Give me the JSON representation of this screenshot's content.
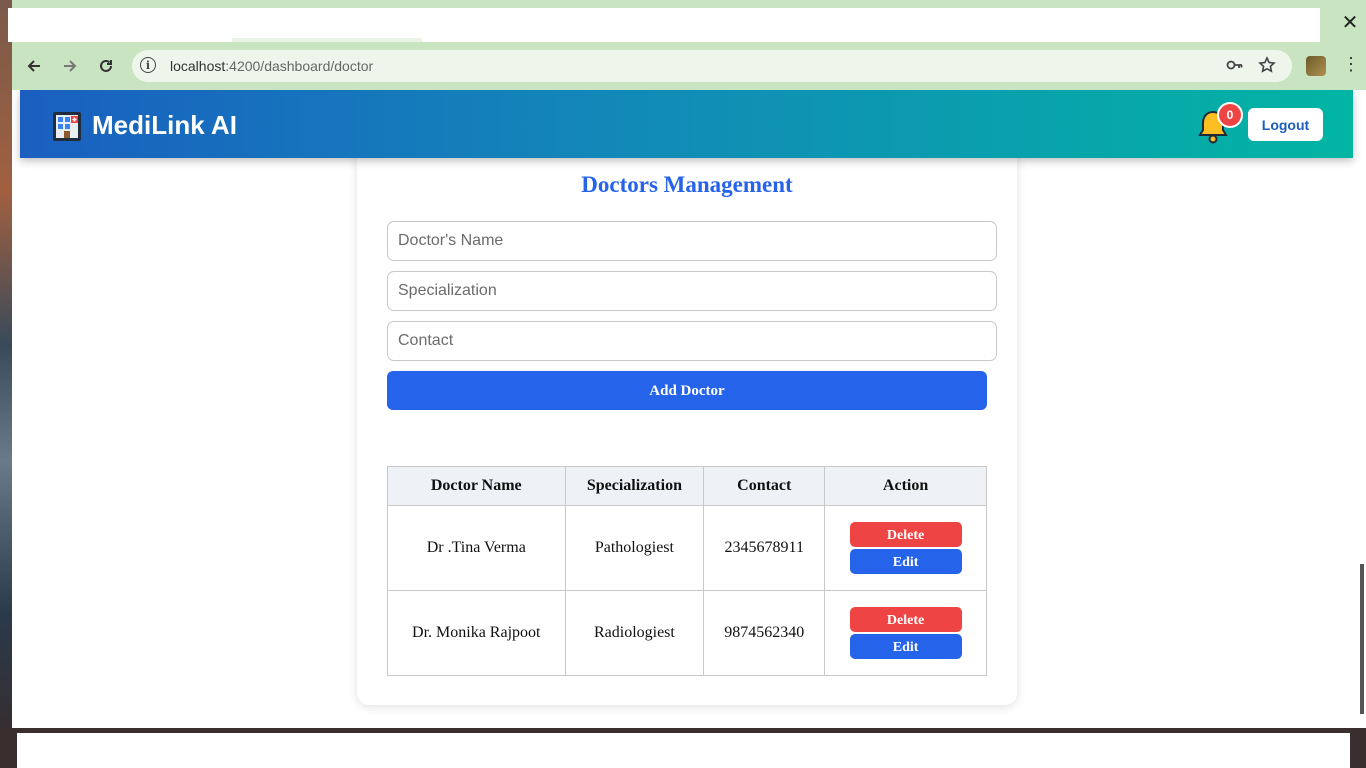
{
  "browser": {
    "url_host": "localhost",
    "url_rest": ":4200/dashboard/doctor",
    "close_glyph": "✕",
    "back_icon": "arrow-left-icon",
    "forward_icon": "arrow-right-icon",
    "reload_icon": "reload-icon",
    "password_icon": "key-icon",
    "bookmark_icon": "star-icon",
    "menu_icon": "kebab-menu-icon"
  },
  "navbar": {
    "brand": "MediLink AI",
    "notification_count": "0",
    "logout_label": "Logout",
    "gradient_start": "#1a5fc0",
    "gradient_end": "#02b5a3"
  },
  "form": {
    "title": "Doctors Management",
    "name_placeholder": "Doctor's Name",
    "name_value": "",
    "specialization_placeholder": "Specialization",
    "specialization_value": "",
    "contact_placeholder": "Contact",
    "contact_value": "",
    "add_label": "Add Doctor"
  },
  "table": {
    "headers": [
      "Doctor Name",
      "Specialization",
      "Contact",
      "Action"
    ],
    "rows": [
      {
        "name": "Dr .Tina Verma",
        "specialization": "Pathologiest",
        "contact": "2345678911"
      },
      {
        "name": "Dr. Monika Rajpoot",
        "specialization": "Radiologiest",
        "contact": "9874562340"
      }
    ],
    "delete_label": "Delete",
    "edit_label": "Edit"
  },
  "colors": {
    "primary": "#2563eb",
    "danger": "#ef4444"
  }
}
